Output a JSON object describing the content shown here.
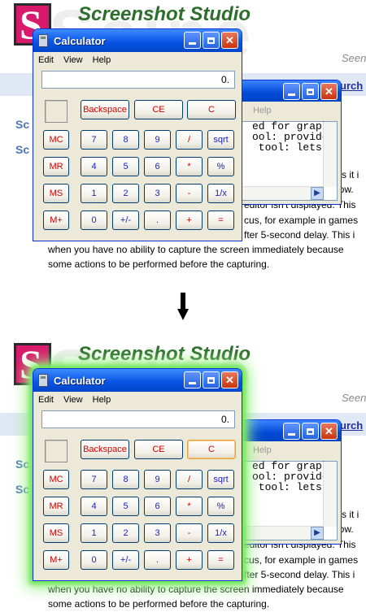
{
  "background_page": {
    "watermark": "Ssine",
    "logo_letter": "S",
    "title": "Screenshot Studio",
    "seen_text": "Seen",
    "purch_text": "urch",
    "sc_links": [
      "Sc",
      "Sc"
    ],
    "text_lines_right": [
      "ed for graph",
      "s it i",
      "dow.",
      "editor isn't displayed. This",
      "cus, for example in games",
      "fter 5-second delay. This i"
    ],
    "text_lines_full": [
      "when you have no ability to capture the screen immediately because",
      "some actions to be performed before the capturing."
    ]
  },
  "notepad": {
    "menu_help": "Help",
    "text_lines": [
      "ed for graph",
      "ool: provide",
      " tool: lets"
    ],
    "scroll_arrow": "▶"
  },
  "calculator": {
    "title": "Calculator",
    "menu": [
      "Edit",
      "View",
      "Help"
    ],
    "display": "0.",
    "top_buttons": [
      "Backspace",
      "CE",
      "C"
    ],
    "memory_buttons": [
      "MC",
      "MR",
      "MS",
      "M+"
    ],
    "keypad_rows": [
      [
        "7",
        "8",
        "9",
        "/",
        "sqrt"
      ],
      [
        "4",
        "5",
        "6",
        "*",
        "%"
      ],
      [
        "1",
        "2",
        "3",
        "-",
        "1/x"
      ],
      [
        "0",
        "+/-",
        ".",
        "+",
        "="
      ]
    ],
    "caption_buttons": [
      "minimize",
      "maximize",
      "close"
    ],
    "close_glyph": "✕"
  },
  "arrow_icon": "down-arrow",
  "colors": {
    "highlight_glow": "#71e95a",
    "title_bar": "#0a55e6",
    "red_label": "#d40000",
    "blue_label": "#1a24c8",
    "logo": "#d9196b"
  }
}
